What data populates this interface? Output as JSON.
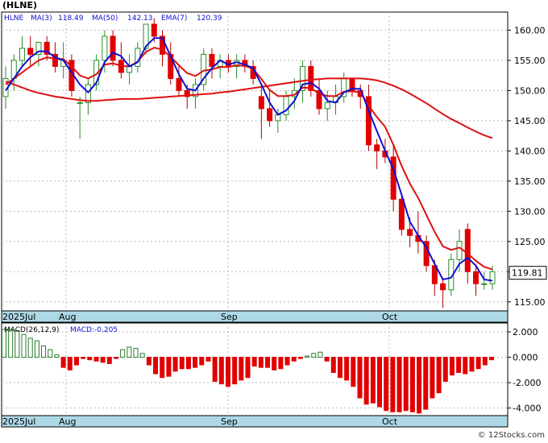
{
  "ticker_label": "(HLNE)",
  "credit": "© 12Stocks.com",
  "legend": {
    "symbol": "HLNE",
    "ma3": "MA(3)",
    "ma3_value": "118.49",
    "ma50": "MA(50)",
    "ma50_value": "142.13",
    "ema7": "EMA(7)",
    "ema7_value": "120.39"
  },
  "macd_legend": {
    "label": "MACD(26,12,9)",
    "value_label": "MACD:-0.205"
  },
  "colors": {
    "up_candle": "#2a8c2a",
    "down_candle": "#e00000",
    "ma_blue": "#1010d0",
    "ma_red": "#e01010",
    "axis_band": "#add8e6",
    "hist_pos": "#2a7a2a",
    "hist_neg": "#e00000"
  },
  "chart_data": [
    {
      "type": "candlestick",
      "title": "HLNE",
      "x_labels": [
        "2025Jul",
        "Aug",
        "Sep",
        "Oct"
      ],
      "ylim": [
        113.5,
        163
      ],
      "yticks": [
        115,
        120,
        125,
        130,
        135,
        140,
        145,
        150,
        155,
        160
      ],
      "last_price": "119.81",
      "candles": [
        [
          149,
          154,
          147,
          152
        ],
        [
          152,
          156,
          150,
          155
        ],
        [
          155,
          159,
          154,
          157
        ],
        [
          157,
          159,
          154,
          156
        ],
        [
          156,
          158,
          154,
          158
        ],
        [
          158,
          159,
          155,
          156
        ],
        [
          156,
          158,
          153,
          154
        ],
        [
          154,
          158,
          152,
          155
        ],
        [
          155,
          156,
          149,
          150
        ],
        [
          148,
          149,
          142,
          148
        ],
        [
          148,
          152,
          146,
          151
        ],
        [
          151,
          156,
          150,
          155
        ],
        [
          155,
          160,
          153,
          159
        ],
        [
          159,
          160,
          154,
          155
        ],
        [
          155,
          158,
          152,
          153
        ],
        [
          153,
          156,
          151,
          154
        ],
        [
          154,
          158,
          153,
          157
        ],
        [
          157,
          161,
          156,
          161
        ],
        [
          161,
          162,
          158,
          159
        ],
        [
          159,
          160,
          154,
          156
        ],
        [
          156,
          158,
          151,
          152
        ],
        [
          152,
          154,
          149,
          150
        ],
        [
          150,
          151,
          147,
          149
        ],
        [
          149,
          152,
          147,
          151
        ],
        [
          151,
          157,
          150,
          156
        ],
        [
          156,
          157,
          152,
          154
        ],
        [
          154,
          156,
          152,
          155
        ],
        [
          155,
          156,
          153,
          154
        ],
        [
          154,
          156,
          152,
          155
        ],
        [
          155,
          156,
          153,
          154
        ],
        [
          154,
          155,
          151,
          152
        ],
        [
          149,
          151,
          142,
          147
        ],
        [
          147,
          150,
          144,
          145
        ],
        [
          145,
          147,
          143,
          146
        ],
        [
          146,
          150,
          145,
          149
        ],
        [
          149,
          152,
          147,
          150
        ],
        [
          150,
          155,
          148,
          154
        ],
        [
          154,
          155,
          149,
          150
        ],
        [
          150,
          152,
          146,
          147
        ],
        [
          147,
          150,
          145,
          148
        ],
        [
          148,
          151,
          146,
          149
        ],
        [
          149,
          153,
          148,
          152
        ],
        [
          152,
          152,
          149,
          150
        ],
        [
          150,
          151,
          147,
          149
        ],
        [
          149,
          151,
          140,
          141
        ],
        [
          141,
          142,
          137,
          140
        ],
        [
          140,
          142,
          138,
          139
        ],
        [
          139,
          141,
          130,
          132
        ],
        [
          132,
          133,
          126,
          127
        ],
        [
          127,
          129,
          124,
          126
        ],
        [
          126,
          130,
          123,
          125
        ],
        [
          125,
          126,
          120,
          121
        ],
        [
          121,
          122,
          116,
          118
        ],
        [
          118,
          119,
          114,
          117
        ],
        [
          117,
          123,
          116,
          122
        ],
        [
          122,
          127,
          120,
          125
        ],
        [
          127,
          128,
          118,
          120
        ],
        [
          120,
          121,
          116,
          118
        ],
        [
          118,
          120,
          117,
          118
        ],
        [
          118,
          121,
          117,
          120
        ]
      ],
      "ma3": [
        150,
        152,
        154,
        155.5,
        156.5,
        156.5,
        155.5,
        155,
        153,
        151,
        149.7,
        151.3,
        154.7,
        156.3,
        155.7,
        154,
        154.7,
        157.3,
        158.7,
        158.7,
        155.7,
        152.7,
        150.3,
        150,
        152,
        153.7,
        155,
        154.3,
        154.7,
        154.3,
        153.7,
        151,
        148,
        146,
        146.7,
        148.3,
        151,
        151.3,
        150.3,
        148.3,
        148,
        149.7,
        150.3,
        150.3,
        146.7,
        143.3,
        140,
        137,
        132.7,
        128.3,
        126,
        124,
        121.3,
        118.7,
        119,
        121.3,
        122.3,
        121,
        118.7,
        118.5
      ],
      "ema7": [
        151,
        152,
        153,
        154,
        155,
        155.5,
        155.3,
        155.2,
        154,
        152.5,
        152,
        152.7,
        154.3,
        154.5,
        154.1,
        154,
        154.8,
        156.4,
        157.1,
        156.8,
        155.6,
        154.2,
        152.9,
        152.4,
        153.3,
        153.5,
        153.9,
        153.9,
        154.2,
        154.1,
        153.6,
        151.9,
        150.1,
        149.1,
        149.1,
        149.3,
        150.5,
        150.4,
        149.5,
        149.1,
        149.1,
        149.8,
        149.9,
        149.7,
        147.5,
        145.6,
        144,
        141,
        137.5,
        134.6,
        132.2,
        129.4,
        126.6,
        124.2,
        123.6,
        124,
        123,
        121.8,
        120.8,
        120.39
      ],
      "ma50": [
        151.5,
        151,
        150.5,
        150,
        149.6,
        149.3,
        149,
        148.8,
        148.6,
        148.4,
        148.3,
        148.3,
        148.4,
        148.5,
        148.6,
        148.6,
        148.6,
        148.7,
        148.8,
        148.9,
        149,
        149.1,
        149.2,
        149.3,
        149.4,
        149.5,
        149.7,
        149.8,
        150,
        150.2,
        150.4,
        150.6,
        150.8,
        151,
        151.2,
        151.4,
        151.6,
        151.8,
        151.9,
        152,
        152,
        152,
        152,
        152,
        151.9,
        151.7,
        151.3,
        150.8,
        150.2,
        149.5,
        148.7,
        147.9,
        147,
        146.1,
        145.3,
        144.6,
        143.9,
        143.2,
        142.6,
        142.13
      ]
    },
    {
      "type": "bar",
      "title": "MACD(26,12,9)",
      "ylim": [
        -4.6,
        2.7
      ],
      "yticks": [
        2.0,
        0.0,
        -2.0,
        -4.0
      ],
      "ytick_labels": [
        "2.000",
        "0.000",
        "-2.000",
        "-4.000"
      ],
      "values": [
        2.2,
        2.2,
        2.1,
        1.8,
        1.5,
        1.3,
        0.9,
        0.6,
        0.2,
        -0.8,
        -1.0,
        -0.6,
        -0.1,
        -0.2,
        -0.3,
        -0.4,
        -0.5,
        -0.1,
        0.6,
        0.8,
        0.7,
        0.3,
        -0.6,
        -1.3,
        -1.6,
        -1.5,
        -1.1,
        -0.9,
        -0.9,
        -0.8,
        -0.6,
        -0.3,
        -1.9,
        -2.1,
        -2.3,
        -2.1,
        -1.8,
        -1.6,
        -0.7,
        -0.8,
        -0.8,
        -1.0,
        -0.9,
        -0.6,
        -0.3,
        -0.1,
        0.1,
        0.3,
        0.4,
        -0.3,
        -1.2,
        -1.6,
        -1.8,
        -2.3,
        -3.2,
        -3.7,
        -3.6,
        -3.9,
        -4.2,
        -4.3,
        -4.3,
        -4.2,
        -4.3,
        -4.4,
        -4.1,
        -3.2,
        -2.8,
        -1.9,
        -1.4,
        -1.2,
        -1.3,
        -1.1,
        -0.9,
        -0.6,
        -0.2
      ],
      "x_labels": [
        "2025Jul",
        "Aug",
        "Sep",
        "Oct"
      ]
    }
  ]
}
